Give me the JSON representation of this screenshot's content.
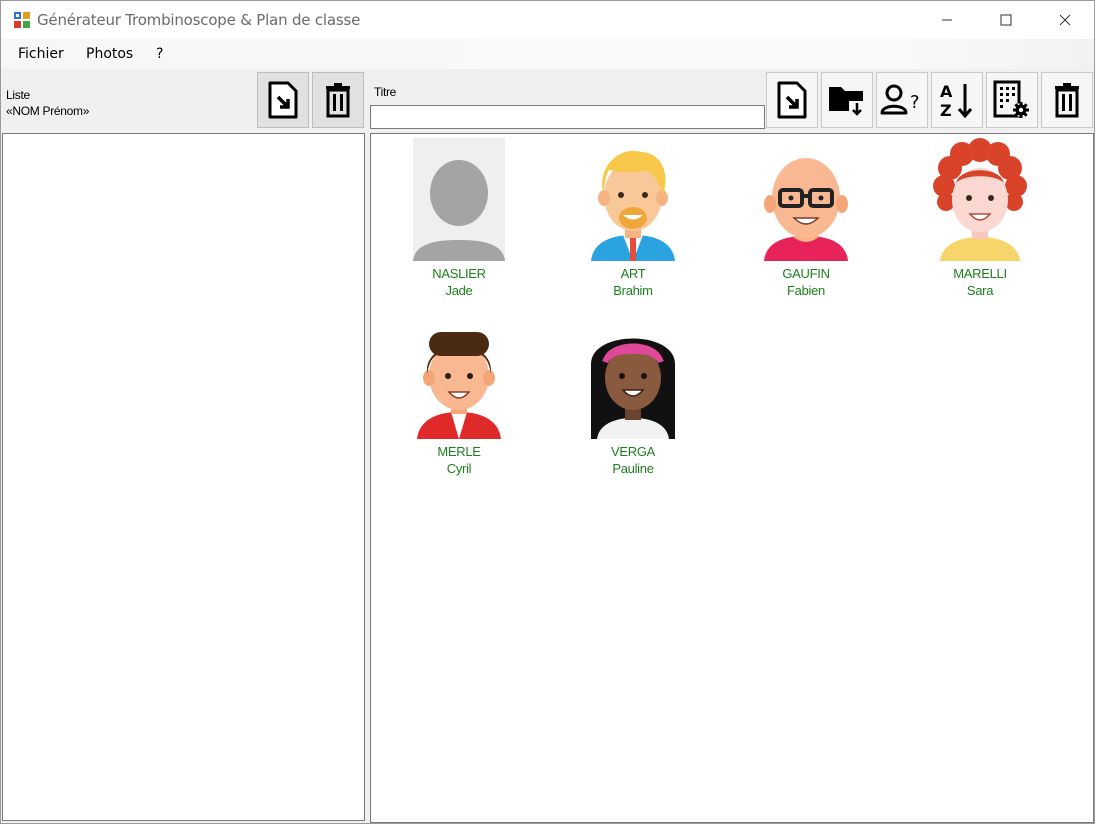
{
  "window": {
    "title": "Générateur Trombinoscope & Plan de classe"
  },
  "menu": {
    "items": [
      "Fichier",
      "Photos",
      "?"
    ]
  },
  "left": {
    "label_line1": "Liste",
    "label_line2": "«NOM Prénom»",
    "buttons": [
      "import-file-icon",
      "trash-icon"
    ]
  },
  "right": {
    "titre_label": "Titre",
    "titre_value": "",
    "buttons": [
      "import-file-icon",
      "folder-download-icon",
      "person-question-icon",
      "sort-az-icon",
      "grid-settings-icon",
      "trash-icon"
    ]
  },
  "students": [
    {
      "nom": "NASLIER",
      "prenom": "Jade",
      "avatar": "placeholder-silhouette"
    },
    {
      "nom": "ART",
      "prenom": "Brahim",
      "avatar": "blond-boy-beard"
    },
    {
      "nom": "GAUFIN",
      "prenom": "Fabien",
      "avatar": "bald-man-glasses"
    },
    {
      "nom": "MARELLI",
      "prenom": "Sara",
      "avatar": "red-curly-girl"
    },
    {
      "nom": "MERLE",
      "prenom": "Cyril",
      "avatar": "brown-hair-boy"
    },
    {
      "nom": "VERGA",
      "prenom": "Pauline",
      "avatar": "dark-skin-girl-headband"
    }
  ],
  "colors": {
    "student_text": "#1d7f1d",
    "toolbar_bg": "#f0f0f0"
  }
}
